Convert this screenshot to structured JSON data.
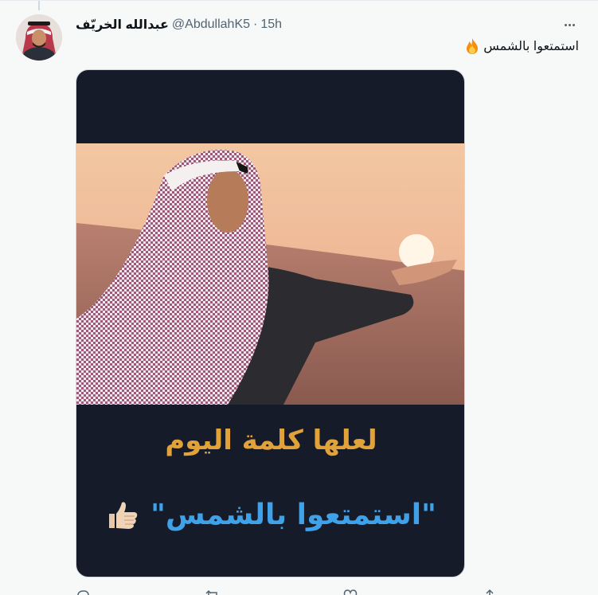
{
  "tweet": {
    "author": {
      "display_name": "عبدالله الخريّف",
      "handle": "@AbdullahK5",
      "separator": "·",
      "time": "15h"
    },
    "text": "استمتعوا بالشمس",
    "text_emoji_icon": "fire-icon",
    "media": {
      "caption_line_1": "لعلها كلمة اليوم",
      "caption_line_2": "\"استمتعوا بالشمس\"",
      "caption_emoji_icon": "thumbs-up-icon",
      "colors": {
        "background": "#161b29",
        "caption_1": "#e2a23a",
        "caption_2": "#3fa2e8"
      }
    },
    "actions": [
      "reply-icon",
      "retweet-icon",
      "like-icon",
      "share-icon"
    ]
  }
}
